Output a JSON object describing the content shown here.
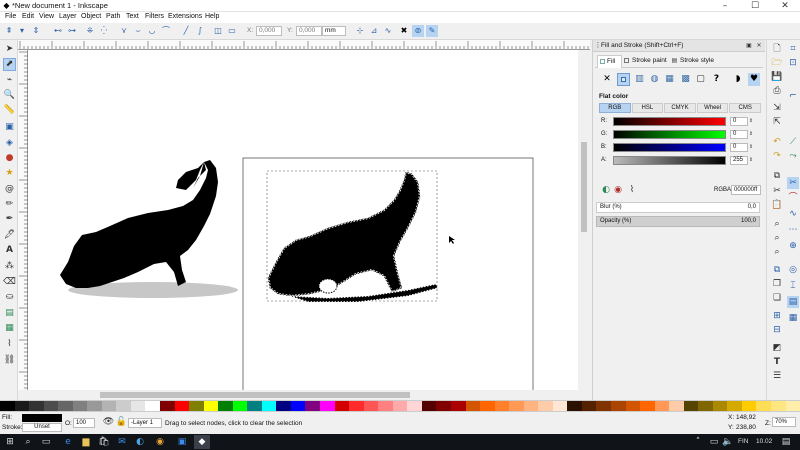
{
  "window": {
    "title": "*New document 1 - Inkscape",
    "minimize": "–",
    "maximize": "☐",
    "close": "✕"
  },
  "menu": [
    "File",
    "Edit",
    "View",
    "Layer",
    "Object",
    "Path",
    "Text",
    "Filters",
    "Extensions",
    "Help"
  ],
  "toolbar": {
    "x_label": "X:",
    "x_value": "0,000",
    "y_label": "Y:",
    "y_value": "0,000",
    "unit": "mm",
    "w_label": "W:",
    "w_value": "0,000",
    "h_label": "H:",
    "h_value": "0,000"
  },
  "fill_stroke": {
    "title": "Fill and Stroke (Shift+Ctrl+F)",
    "tabs": [
      "Fill",
      "Stroke paint",
      "Stroke style"
    ],
    "mode_label": "Flat color",
    "models": [
      "RGB",
      "HSL",
      "CMYK",
      "Wheel",
      "CMS"
    ],
    "channels": [
      {
        "label": "R:",
        "value": "0",
        "gradient": "linear-gradient(90deg,#000,#ff0000)"
      },
      {
        "label": "G:",
        "value": "0",
        "gradient": "linear-gradient(90deg,#000,#00ff00)"
      },
      {
        "label": "B:",
        "value": "0",
        "gradient": "linear-gradient(90deg,#000,#0000ff)"
      },
      {
        "label": "A:",
        "value": "255",
        "gradient": "linear-gradient(90deg,#bbb,#000)"
      }
    ],
    "rgba_label": "RGBA:",
    "rgba_value": "000000ff",
    "blur_label": "Blur (%)",
    "blur_value": "0,0",
    "opacity_label": "Opacity (%)",
    "opacity_value": "100,0"
  },
  "status": {
    "fill_label": "Fill:",
    "stroke_label": "Stroke:",
    "stroke_value": "Unset",
    "opacity_label": "O:",
    "opacity_value": "100",
    "layer": "-Layer 1",
    "message": "Drag to select nodes, click to clear the selection",
    "x_label": "X:",
    "x_value": "148,92",
    "y_label": "Y:",
    "y_value": "238,80",
    "zoom_label": "Z:",
    "zoom_value": "70%"
  },
  "taskbar": {
    "lang": "FIN",
    "time": "10.02"
  },
  "palette": [
    "#000000",
    "#1a1a1a",
    "#333333",
    "#4d4d4d",
    "#666666",
    "#808080",
    "#999999",
    "#b3b3b3",
    "#cccccc",
    "#e6e6e6",
    "#ffffff",
    "#800000",
    "#ff0000",
    "#808000",
    "#ffff00",
    "#008000",
    "#00ff00",
    "#008080",
    "#00ffff",
    "#000080",
    "#0000ff",
    "#800080",
    "#ff00ff",
    "#d40000",
    "#ff2a2a",
    "#ff5555",
    "#ff8080",
    "#ffaaaa",
    "#ffd5d5",
    "#550000",
    "#800000",
    "#aa0000",
    "#d45500",
    "#ff6600",
    "#ff7f2a",
    "#ff9955",
    "#ffb380",
    "#ffccaa",
    "#ffe6d5",
    "#2b1100",
    "#552200",
    "#803300",
    "#aa4400",
    "#d45500",
    "#ff6600",
    "#ff9955",
    "#ffccaa",
    "#554400",
    "#806600",
    "#aa8800",
    "#d4aa00",
    "#ffcc00",
    "#ffdd55",
    "#ffe680",
    "#ffeeaa"
  ]
}
